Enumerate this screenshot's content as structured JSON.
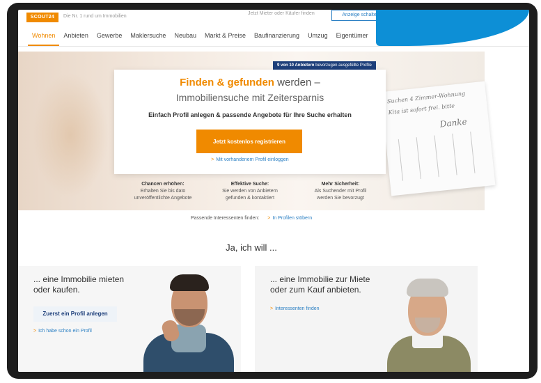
{
  "topbar": {
    "logo": "SCOUT24",
    "tagline": "Die Nr. 1 rund um Immobilien",
    "hint": "Jetzt Mieter oder Käufer finden",
    "button": "Anzeige schalten"
  },
  "nav": {
    "items": [
      "Wohnen",
      "Anbieten",
      "Gewerbe",
      "Maklersuche",
      "Neubau",
      "Markt & Preise",
      "Baufinanzierung",
      "Umzug",
      "Eigentümer"
    ]
  },
  "hero": {
    "badge_bold": "9 von 10 Anbietern",
    "badge_rest": "bevorzugen ausgefüllte Profile",
    "title_accent": "Finden & gefunden",
    "title_rest": "werden –",
    "subtitle": "Immobiliensuche mit Zeitersparnis",
    "description": "Einfach Profil anlegen & passende Angebote für Ihre Suche erhalten",
    "cta": "Jetzt kostenlos registrieren",
    "login_link": "Mit vorhandenem Profil einloggen",
    "note_lines": [
      "Suchen 4 Zimmer-Wohnung",
      "Kita ist sofort frei. bitte",
      "Danke"
    ]
  },
  "benefits": [
    {
      "title": "Chancen erhöhen:",
      "line1": "Erhalten Sie bis dato",
      "line2": "unveröffentlichte Angebote"
    },
    {
      "title": "Effektive Suche:",
      "line1": "Sie werden von Anbietern",
      "line2": "gefunden & kontaktiert"
    },
    {
      "title": "Mehr Sicherheit:",
      "line1": "Als Suchender mit Profil",
      "line2": "werden Sie bevorzugt"
    }
  ],
  "browse": {
    "label": "Passende Interessenten finden:",
    "link": "In Profilen stöbern"
  },
  "section": {
    "title": "Ja, ich will ..."
  },
  "panels": {
    "left": {
      "line1": "... eine Immobilie mieten",
      "line2": "oder kaufen.",
      "button": "Zuerst ein Profil anlegen",
      "link": "Ich habe schon ein Profil"
    },
    "right": {
      "line1": "... eine Immobilie zur Miete",
      "line2": "oder zum Kauf anbieten.",
      "link": "Interessenten finden"
    }
  },
  "colors": {
    "accent": "#f08a00",
    "link": "#2a7fc3",
    "navy": "#1d3f7a",
    "frame": "#1e1e1e",
    "corner": "#0d8fd6"
  },
  "icons": {
    "link_arrow": "chevron-right-icon"
  }
}
